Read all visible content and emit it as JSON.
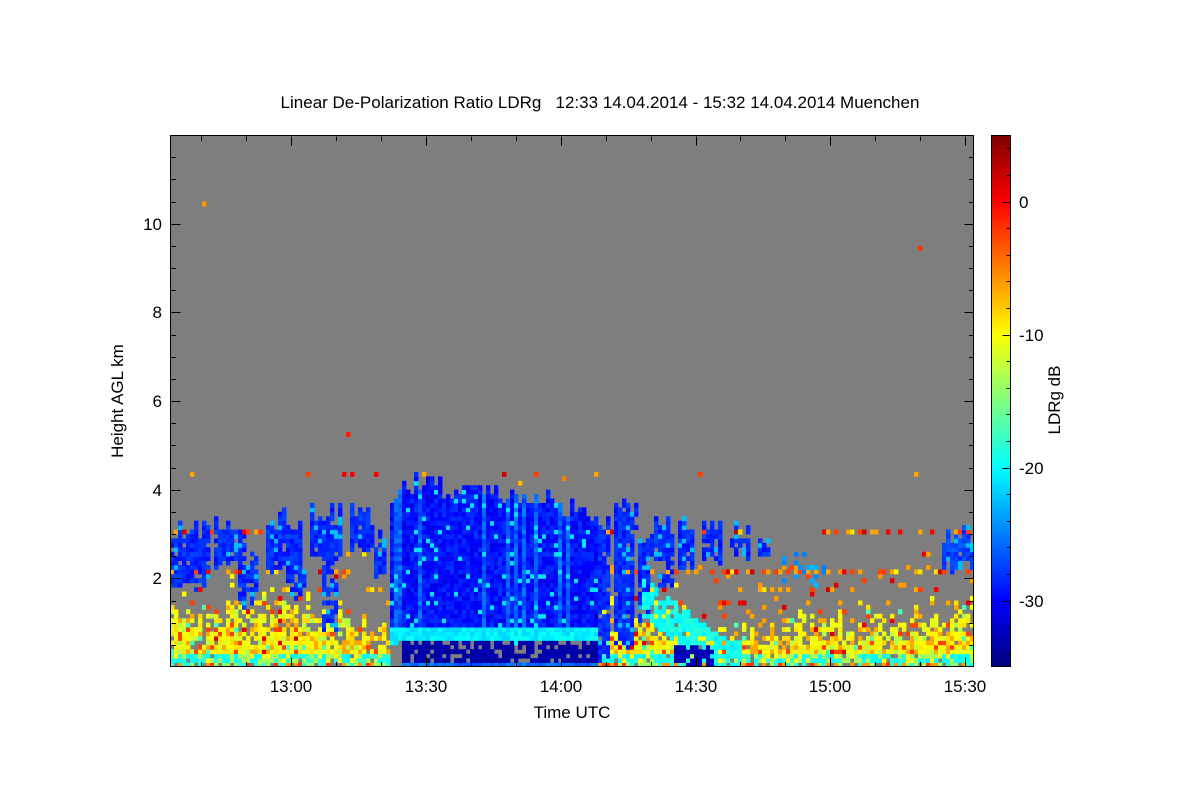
{
  "chart_data": {
    "type": "heatmap",
    "title": "Linear De-Polarization Ratio LDRg   12:33 14.04.2014 - 15:32 14.04.2014 Muenchen",
    "xlabel": "Time UTC",
    "ylabel": "Height AGL km",
    "colorbar_label": "LDRg dB",
    "colormap": "jet",
    "site": "Muenchen",
    "time_start": "12:33 14.04.2014",
    "time_end": "15:32 14.04.2014",
    "no_data_color": "#7e7e7e",
    "x_range_minutes": [
      0,
      179
    ],
    "x_ticks": [
      {
        "min": 27,
        "label": "13:00"
      },
      {
        "min": 57,
        "label": "13:30"
      },
      {
        "min": 87,
        "label": "14:00"
      },
      {
        "min": 117,
        "label": "14:30"
      },
      {
        "min": 147,
        "label": "15:00"
      },
      {
        "min": 177,
        "label": "15:30"
      }
    ],
    "x_minor_step_min": 10,
    "y_range_km": [
      0,
      12
    ],
    "y_ticks": [
      {
        "km": 2,
        "label": "2"
      },
      {
        "km": 4,
        "label": "4"
      },
      {
        "km": 6,
        "label": "6"
      },
      {
        "km": 8,
        "label": "8"
      },
      {
        "km": 10,
        "label": "10"
      }
    ],
    "y_minor_step_km": 0.5,
    "colorbar_range_db": [
      -35,
      5
    ],
    "colorbar_ticks": [
      {
        "db": 0,
        "label": "0"
      },
      {
        "db": -10,
        "label": "-10"
      },
      {
        "db": -20,
        "label": "-20"
      },
      {
        "db": -30,
        "label": "-30"
      }
    ],
    "colorbar_minor_step_db": 2,
    "features": {
      "boundary_layer": {
        "base_top_km": 1.05,
        "spike_max_km": 0.75,
        "speck_ceiling_km": 2.3,
        "main_db": -10,
        "low_level_db": -17,
        "surface_mix_db": [
          -14,
          -18.5,
          -6,
          -2
        ]
      },
      "artifact_lines": [
        {
          "h": 4.35,
          "density": 0.07
        },
        {
          "h": 3.05,
          "density": 0.3
        },
        {
          "h": 2.55,
          "density": 0.09
        },
        {
          "h": 2.15,
          "density": 0.46
        },
        {
          "h": 1.75,
          "density": 0.11
        },
        {
          "h": 1.45,
          "density": 0.16
        }
      ],
      "cloud_blobs": [
        {
          "m": [
            0,
            9
          ],
          "h": [
            2.15,
            3.05
          ]
        },
        {
          "m": [
            0,
            8
          ],
          "h": [
            1.8,
            2.35
          ],
          "p": 0.7
        },
        {
          "m": [
            10,
            17
          ],
          "h": [
            2.35,
            3.25
          ]
        },
        {
          "m": [
            15,
            20
          ],
          "h": [
            1.45,
            2.5
          ],
          "p": 0.75
        },
        {
          "m": [
            21,
            29
          ],
          "h": [
            2.2,
            3.35
          ]
        },
        {
          "m": [
            26,
            30
          ],
          "h": [
            1.5,
            2.4
          ],
          "p": 0.7
        },
        {
          "m": [
            31,
            38
          ],
          "h": [
            2.45,
            3.5
          ]
        },
        {
          "m": [
            34,
            37
          ],
          "h": [
            0.95,
            2.5
          ],
          "p": 0.65
        },
        {
          "m": [
            40,
            45
          ],
          "h": [
            2.7,
            3.45
          ]
        },
        {
          "m": [
            45,
            48
          ],
          "h": [
            2.0,
            2.9
          ],
          "p": 0.8
        },
        {
          "m": [
            95,
            98
          ],
          "h": [
            0.15,
            3.3
          ]
        },
        {
          "m": [
            99,
            103
          ],
          "h": [
            0.5,
            3.55
          ]
        },
        {
          "m": [
            101,
            104
          ],
          "h": [
            3.1,
            3.65
          ]
        },
        {
          "m": [
            104,
            107
          ],
          "h": [
            1.15,
            2.95
          ]
        },
        {
          "m": [
            107,
            112
          ],
          "h": [
            2.35,
            3.2
          ]
        },
        {
          "m": [
            109,
            112
          ],
          "h": [
            1.75,
            2.35
          ],
          "p": 0.7
        },
        {
          "m": [
            113,
            117
          ],
          "h": [
            2.25,
            3.15
          ]
        },
        {
          "m": [
            118,
            123
          ],
          "h": [
            2.45,
            3.2
          ]
        },
        {
          "m": [
            125,
            129
          ],
          "h": [
            2.55,
            3.05
          ],
          "p": 0.8
        },
        {
          "m": [
            131,
            134
          ],
          "h": [
            2.5,
            2.95
          ],
          "p": 0.55
        },
        {
          "m": [
            136,
            146
          ],
          "h": [
            1.85,
            2.6
          ],
          "p": 0.22,
          "db": -24
        },
        {
          "m": [
            172,
            179
          ],
          "h": [
            2.25,
            2.95
          ],
          "db": -27.5
        }
      ],
      "main_cloud": {
        "m": [
          49,
          95
        ],
        "base": 0.95,
        "db": -29.5,
        "top_profile": [
          [
            49,
            3.5
          ],
          [
            52,
            3.9
          ],
          [
            56,
            4.0
          ],
          [
            62,
            3.9
          ],
          [
            68,
            4.0
          ],
          [
            74,
            3.9
          ],
          [
            79,
            3.8
          ],
          [
            84,
            3.65
          ],
          [
            89,
            3.5
          ],
          [
            95,
            3.25
          ]
        ]
      },
      "base_band": {
        "m": [
          49,
          95
        ],
        "h": [
          0.58,
          0.95
        ],
        "db": -20.5
      },
      "dark_stripe": {
        "m": [
          52,
          95
        ],
        "h": [
          0.12,
          0.58
        ],
        "db": -34,
        "p": 0.78
      },
      "cloud_floor": {
        "m": [
          52,
          95
        ],
        "h": [
          0,
          0.12
        ],
        "db": -26
      },
      "cyan_streak": {
        "m": [
          105,
          127
        ],
        "h_start": 1.6,
        "slope": 0.075,
        "half_width": 0.45,
        "db": -19.5,
        "p": 0.72
      },
      "ground_patch": {
        "m": [
          112,
          121
        ],
        "h": [
          0.05,
          0.5
        ],
        "db": -33.5,
        "p": 0.8
      },
      "specks": [
        {
          "m": 8,
          "h": 10.45,
          "db": -6
        },
        {
          "m": 167,
          "h": 9.45,
          "db": -2
        },
        {
          "m": 40,
          "h": 5.25,
          "db": -1
        },
        {
          "m": 88,
          "h": 4.25,
          "db": -5
        },
        {
          "m": 78,
          "h": 4.15,
          "db": -7
        }
      ]
    }
  }
}
